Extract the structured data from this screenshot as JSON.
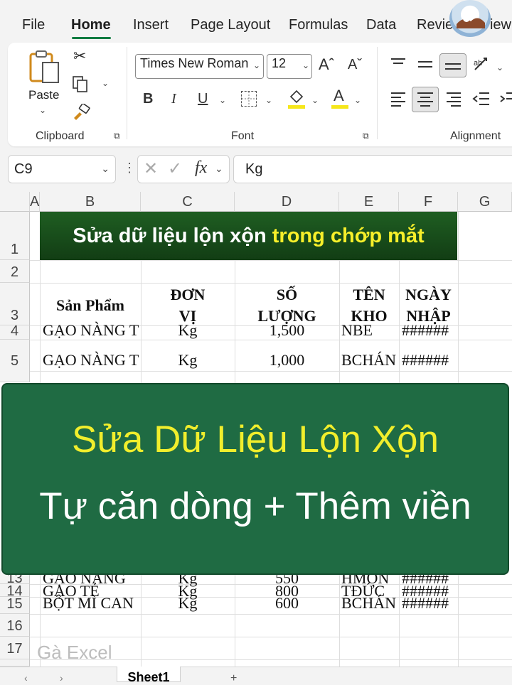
{
  "menu": {
    "file": "File",
    "home": "Home",
    "insert": "Insert",
    "page_layout": "Page Layout",
    "formulas": "Formulas",
    "data": "Data",
    "review": "Review",
    "view": "View"
  },
  "ribbon": {
    "paste_label": "Paste",
    "clipboard_label": "Clipboard",
    "font_label": "Font",
    "alignment_label": "Alignment",
    "font_name": "Times New Roman",
    "font_size": "12",
    "bold": "B",
    "italic": "I",
    "underline": "U",
    "font_color_letter": "A"
  },
  "formula_bar": {
    "cell_ref": "C9",
    "fx": "fx",
    "content": "Kg"
  },
  "columns": [
    "A",
    "B",
    "C",
    "D",
    "E",
    "F",
    "G"
  ],
  "rows": [
    "1",
    "2",
    "3",
    "4",
    "5",
    "13",
    "14",
    "15",
    "16",
    "17"
  ],
  "title": {
    "part1": "Sửa dữ liệu lộn xộn ",
    "part2": "trong chớp mắt"
  },
  "table_header": {
    "product": "Sản Phẩm",
    "unit_1": "ĐƠN",
    "unit_2": "VỊ",
    "qty_1": "SỐ",
    "qty_2": "LƯỢNG",
    "store_1": "TÊN",
    "store_2": "KHO",
    "date_1": "NGÀY",
    "date_2": "NHẬP"
  },
  "data_rows": [
    {
      "row": "4",
      "product": "GẠO NÀNG T",
      "unit": "Kg",
      "qty": "1,500",
      "store": "NBE",
      "date": "######"
    },
    {
      "row": "5",
      "product": "GẠO NÀNG T",
      "unit": "Kg",
      "qty": "1,000",
      "store": "BCHÁN",
      "date": "######"
    },
    {
      "row": "13",
      "product": "GẠO NÀNG",
      "unit": "Kg",
      "qty": "550",
      "store": "HMÔN",
      "date": "######"
    },
    {
      "row": "14",
      "product": "GẠO TẺ",
      "unit": "Kg",
      "qty": "800",
      "store": "TĐỨC",
      "date": "######"
    },
    {
      "row": "15",
      "product": "BỘT MÌ CAN",
      "unit": "Kg",
      "qty": "600",
      "store": "BCHÁN",
      "date": "######"
    }
  ],
  "overlay": {
    "line1": "Sửa Dữ Liệu Lộn Xộn",
    "line2": "Tự căn dòng + Thêm viền"
  },
  "watermark": "Gà Excel",
  "sheet_tab": "Sheet1",
  "colors": {
    "accent": "#107c41",
    "title_bg": "#1a5a1e",
    "overlay_bg": "#1f6b43",
    "highlight": "#f7ef2a"
  }
}
